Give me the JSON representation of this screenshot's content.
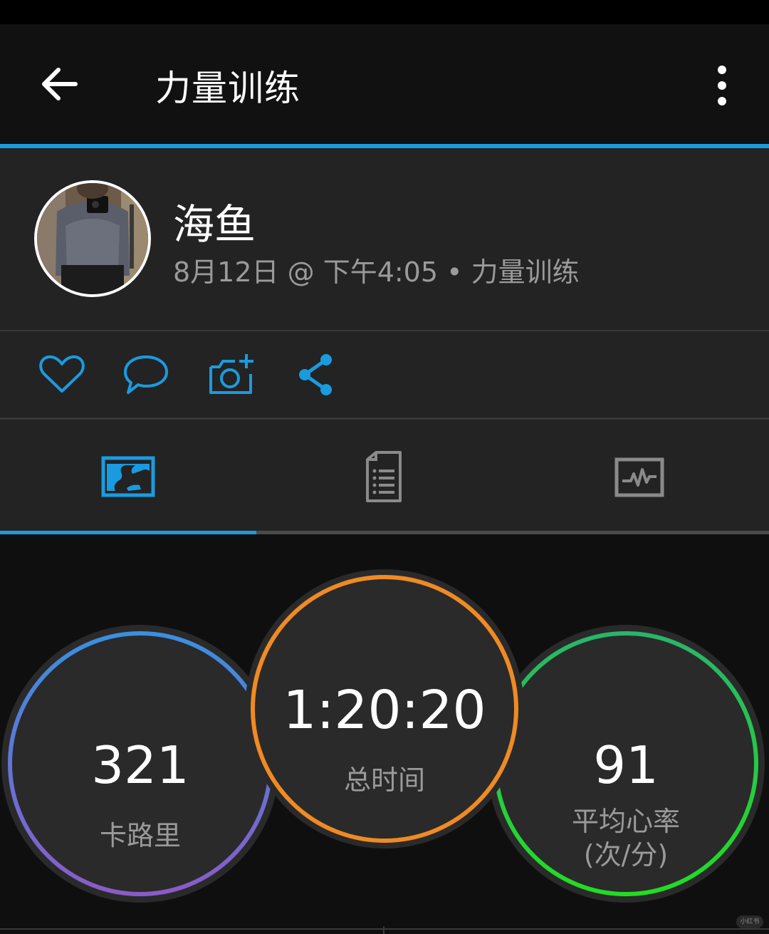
{
  "appbar": {
    "title": "力量训练"
  },
  "profile": {
    "name": "海鱼",
    "meta": "8月12日 @ 下午4:05 • 力量训练"
  },
  "actions": [
    {
      "icon": "heart-icon"
    },
    {
      "icon": "comment-icon"
    },
    {
      "icon": "add-photo-icon"
    },
    {
      "icon": "share-icon"
    }
  ],
  "tabs": [
    {
      "icon": "map-icon",
      "selected": true
    },
    {
      "icon": "details-list-icon",
      "selected": false
    },
    {
      "icon": "chart-activity-icon",
      "selected": false
    }
  ],
  "stats": {
    "calories": {
      "value": "321",
      "label": "卡路里"
    },
    "total_time": {
      "value": "1:20:20",
      "label": "总时间"
    },
    "avg_hr": {
      "value": "91",
      "label_line1": "平均心率",
      "label_line2": "(次/分)"
    }
  },
  "watermark": "小红书",
  "colors": {
    "accent": "#1a9be0",
    "ring_calories": [
      "#3a8fe0",
      "#8a5bc8"
    ],
    "ring_time": "#f08a24",
    "ring_hr": [
      "#2ab46a",
      "#22dd22"
    ]
  }
}
